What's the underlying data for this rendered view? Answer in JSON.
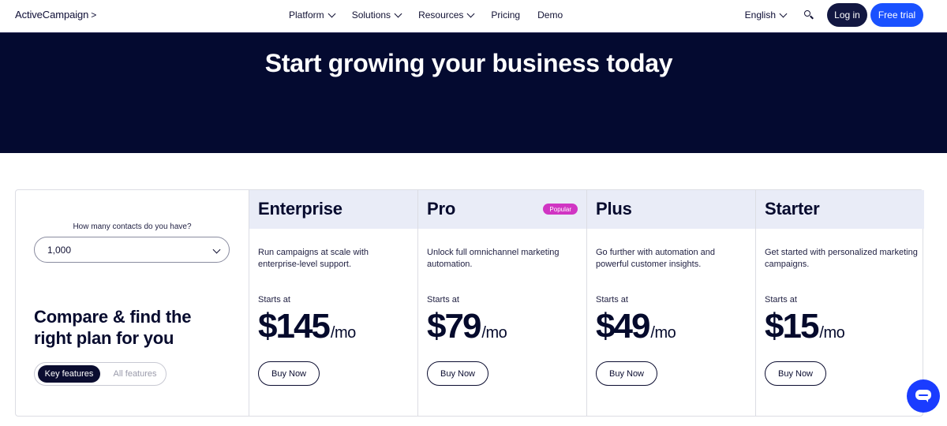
{
  "header": {
    "logo_text": "ActiveCampaign",
    "logo_chevron": ">",
    "nav": [
      {
        "label": "Platform",
        "has_dropdown": true
      },
      {
        "label": "Solutions",
        "has_dropdown": true
      },
      {
        "label": "Resources",
        "has_dropdown": true
      },
      {
        "label": "Pricing",
        "has_dropdown": false
      },
      {
        "label": "Demo",
        "has_dropdown": false
      }
    ],
    "language": "English",
    "login_label": "Log in",
    "trial_label": "Free trial"
  },
  "hero": {
    "title": "Start growing your business today"
  },
  "selector": {
    "label": "How many contacts do you have?",
    "value": "1,000"
  },
  "compare": {
    "title": "Compare & find the right plan for you",
    "toggle_active": "Key features",
    "toggle_inactive": "All features"
  },
  "plans": [
    {
      "name": "Enterprise",
      "badge": "",
      "description": "Run campaigns at scale with enterprise-level support.",
      "starts_label": "Starts at",
      "price": "$145",
      "period": "/mo",
      "cta": "Buy Now"
    },
    {
      "name": "Pro",
      "badge": "Popular",
      "description": "Unlock full omnichannel marketing automation.",
      "starts_label": "Starts at",
      "price": "$79",
      "period": "/mo",
      "cta": "Buy Now"
    },
    {
      "name": "Plus",
      "badge": "",
      "description": "Go further with automation and powerful customer insights.",
      "starts_label": "Starts at",
      "price": "$49",
      "period": "/mo",
      "cta": "Buy Now"
    },
    {
      "name": "Starter",
      "badge": "",
      "description": "Get started with personalized marketing campaigns.",
      "starts_label": "Starts at",
      "price": "$15",
      "period": "/mo",
      "cta": "Buy Now"
    }
  ],
  "colors": {
    "hero_bg": "#040a30",
    "primary_blue": "#1a51ff",
    "badge_pink": "#d035c3",
    "plan_header_bg": "#e9ecf7"
  },
  "icons": {
    "search": "search-icon",
    "chat": "chat-icon",
    "dropdown": "chevron-down-icon"
  }
}
